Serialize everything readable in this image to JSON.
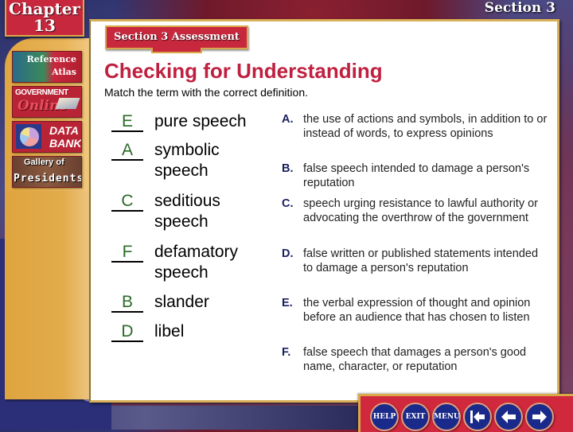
{
  "header": {
    "chapter_label": "Chapter",
    "chapter_number": "13",
    "section_label": "Section 3",
    "assessment_tab": "Section 3 Assessment"
  },
  "sidebar": {
    "items": [
      {
        "line1": "Reference",
        "line2": "Atlas",
        "icon": "globe-map-icon"
      },
      {
        "line1": "GOVERNMENT",
        "line2": "Online",
        "icon": "book-icon"
      },
      {
        "line1": "DATA",
        "line2": "BANK",
        "icon": "pie-chart-icon"
      },
      {
        "line1": "Gallery of",
        "line2": "Presidents",
        "icon": "presidents-portrait-icon"
      }
    ]
  },
  "main": {
    "title": "Checking for Understanding",
    "instructions": "Match the term with the correct definition.",
    "terms": [
      {
        "answer": "E",
        "label": "pure speech"
      },
      {
        "answer": "A",
        "label": "symbolic speech"
      },
      {
        "answer": "C",
        "label": "seditious speech"
      },
      {
        "answer": "F",
        "label": "defamatory speech"
      },
      {
        "answer": "B",
        "label": "slander"
      },
      {
        "answer": "D",
        "label": "libel"
      }
    ],
    "definitions": [
      {
        "letter": "A.",
        "text": "the use of actions and symbols, in addition to or instead of words, to express opinions"
      },
      {
        "letter": "B.",
        "text": "false speech intended to damage a person's reputation"
      },
      {
        "letter": "C.",
        "text": "speech urging resistance to lawful authority or advocating the overthrow of the government"
      },
      {
        "letter": "D.",
        "text": "false written or published statements intended to damage a person's reputation"
      },
      {
        "letter": "E.",
        "text": "the verbal expression of thought and opinion before an audience that has chosen to listen"
      },
      {
        "letter": "F.",
        "text": "false speech that damages a person's good name, character, or reputation"
      }
    ]
  },
  "nav": {
    "help": "HELP",
    "exit": "EXIT",
    "menu": "MENU",
    "first_icon": "first-page-arrow-icon",
    "back_icon": "back-arrow-icon",
    "forward_icon": "forward-arrow-icon"
  },
  "colors": {
    "accent_red": "#c8283e",
    "title_red": "#c02040",
    "gold": "#d9a84a",
    "answer_green": "#2a6a2a",
    "definition_letter": "#1a2060",
    "nav_button_blue": "#1a2a8a"
  }
}
